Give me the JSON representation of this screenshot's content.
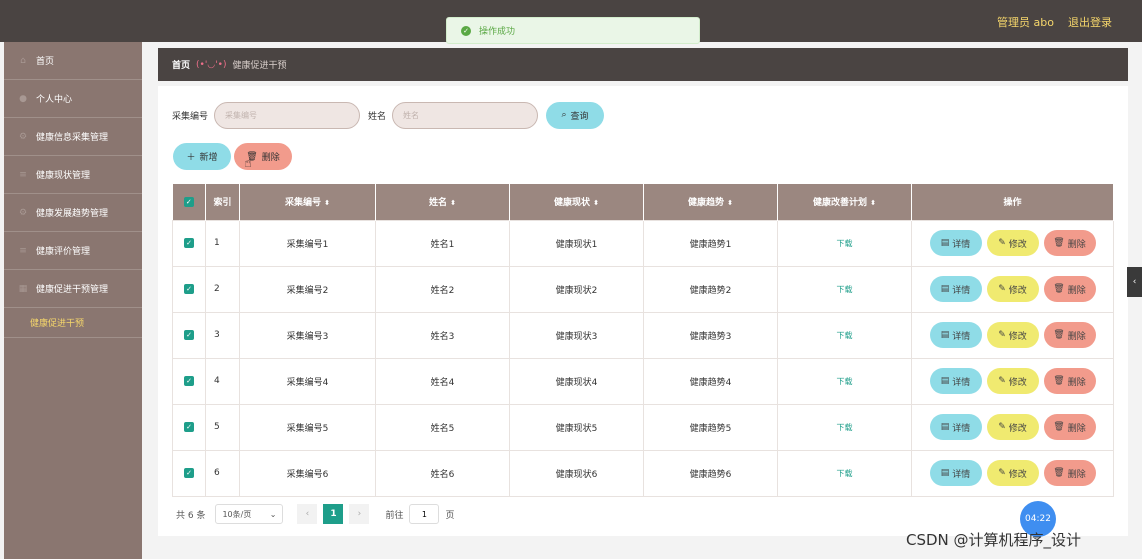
{
  "topbar": {
    "user": "管理员 abo",
    "logout": "退出登录"
  },
  "toast": {
    "message": "操作成功"
  },
  "sidebar": {
    "items": [
      {
        "label": "首页",
        "icon": "home-icon"
      },
      {
        "label": "个人中心",
        "icon": "user-icon"
      },
      {
        "label": "健康信息采集管理",
        "icon": "gear-icon"
      },
      {
        "label": "健康现状管理",
        "icon": "list-icon"
      },
      {
        "label": "健康发展趋势管理",
        "icon": "gear-icon"
      },
      {
        "label": "健康评价管理",
        "icon": "list-icon"
      },
      {
        "label": "健康促进干预管理",
        "icon": "grid-icon"
      }
    ],
    "sub_item": "健康促进干预"
  },
  "breadcrumb": {
    "home": "首页",
    "face": "(•'◡'•)",
    "current": "健康促进干预"
  },
  "search": {
    "code_label": "采集编号",
    "code_placeholder": "采集编号",
    "name_label": "姓名",
    "name_placeholder": "姓名",
    "button": "查询"
  },
  "actions": {
    "add": "新增",
    "delete": "删除"
  },
  "table": {
    "headers": {
      "index": "索引",
      "code": "采集编号",
      "name": "姓名",
      "status": "健康现状",
      "trend": "健康趋势",
      "plan": "健康改善计划",
      "ops": "操作"
    },
    "rows": [
      {
        "index": "1",
        "code": "采集编号1",
        "name": "姓名1",
        "status": "健康现状1",
        "trend": "健康趋势1",
        "plan": "下载"
      },
      {
        "index": "2",
        "code": "采集编号2",
        "name": "姓名2",
        "status": "健康现状2",
        "trend": "健康趋势2",
        "plan": "下载"
      },
      {
        "index": "3",
        "code": "采集编号3",
        "name": "姓名3",
        "status": "健康现状3",
        "trend": "健康趋势3",
        "plan": "下载"
      },
      {
        "index": "4",
        "code": "采集编号4",
        "name": "姓名4",
        "status": "健康现状4",
        "trend": "健康趋势4",
        "plan": "下载"
      },
      {
        "index": "5",
        "code": "采集编号5",
        "name": "姓名5",
        "status": "健康现状5",
        "trend": "健康趋势5",
        "plan": "下载"
      },
      {
        "index": "6",
        "code": "采集编号6",
        "name": "姓名6",
        "status": "健康现状6",
        "trend": "健康趋势6",
        "plan": "下载"
      }
    ],
    "op_labels": {
      "detail": "详情",
      "edit": "修改",
      "remove": "删除"
    }
  },
  "pager": {
    "total": "共 6 条",
    "size": "10条/页",
    "page": "1",
    "goto_label": "前往",
    "goto_value": "1",
    "page_suffix": "页"
  },
  "clock": "04:22",
  "watermark": "CSDN @计算机程序_设计"
}
